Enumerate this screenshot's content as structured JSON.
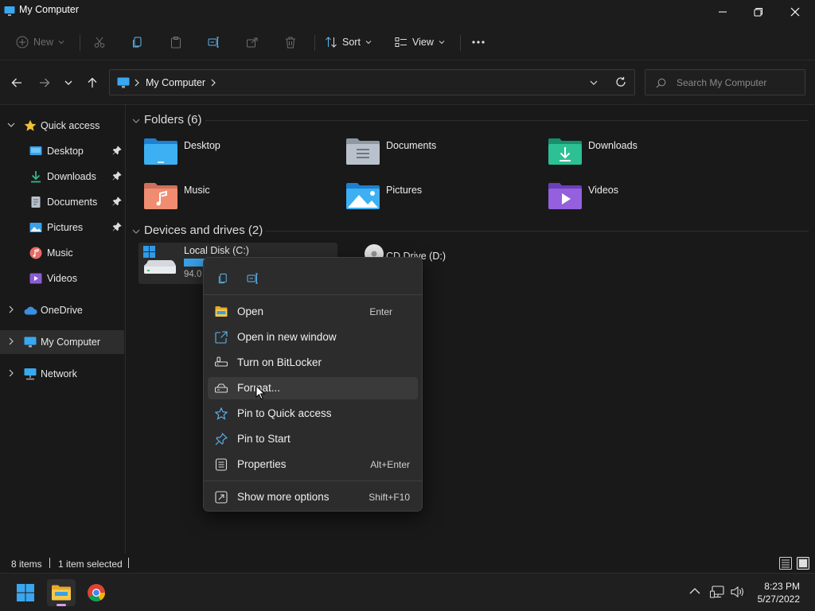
{
  "window": {
    "title": "My Computer"
  },
  "toolbar": {
    "new_label": "New",
    "sort_label": "Sort",
    "view_label": "View"
  },
  "address": {
    "location": "My Computer"
  },
  "search": {
    "placeholder": "Search My Computer"
  },
  "sidebar": {
    "items": [
      {
        "label": "Quick access"
      },
      {
        "label": "Desktop"
      },
      {
        "label": "Downloads"
      },
      {
        "label": "Documents"
      },
      {
        "label": "Pictures"
      },
      {
        "label": "Music"
      },
      {
        "label": "Videos"
      },
      {
        "label": "OneDrive"
      },
      {
        "label": "My Computer"
      },
      {
        "label": "Network"
      }
    ]
  },
  "folders": {
    "title": "Folders (6)",
    "items": [
      {
        "label": "Desktop"
      },
      {
        "label": "Documents"
      },
      {
        "label": "Downloads"
      },
      {
        "label": "Music"
      },
      {
        "label": "Pictures"
      },
      {
        "label": "Videos"
      }
    ]
  },
  "drives": {
    "title": "Devices and drives (2)",
    "items": [
      {
        "label": "Local Disk (C:)",
        "space_text": "94.0",
        "used_fraction": 0.45
      },
      {
        "label": "CD Drive (D:)"
      }
    ]
  },
  "context_menu": {
    "items": [
      {
        "label": "Open",
        "shortcut": "Enter"
      },
      {
        "label": "Open in new window",
        "shortcut": ""
      },
      {
        "label": "Turn on BitLocker",
        "shortcut": ""
      },
      {
        "label": "Format...",
        "shortcut": ""
      },
      {
        "label": "Pin to Quick access",
        "shortcut": ""
      },
      {
        "label": "Pin to Start",
        "shortcut": ""
      },
      {
        "label": "Properties",
        "shortcut": "Alt+Enter"
      },
      {
        "label": "Show more options",
        "shortcut": "Shift+F10"
      }
    ]
  },
  "status": {
    "item_count": "8 items",
    "selection": "1 item selected"
  },
  "taskbar": {
    "time": "8:23 PM",
    "date": "5/27/2022"
  },
  "colors": {
    "accent": "#3aa0e8",
    "background": "#191919",
    "menu": "#2c2c2c",
    "folder_yellow": "#f3c037"
  }
}
